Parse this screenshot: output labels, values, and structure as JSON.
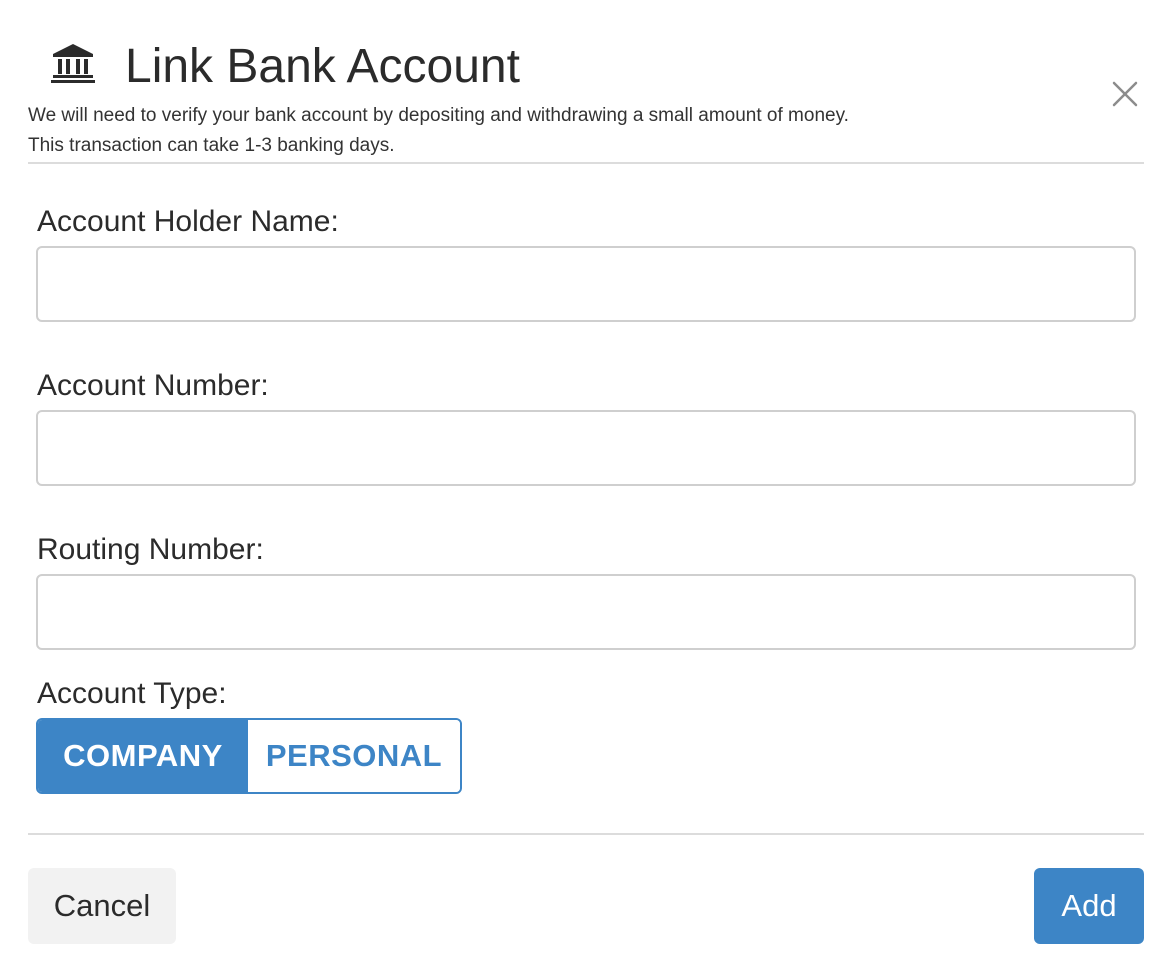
{
  "dialog": {
    "title": "Link Bank Account",
    "icon": "bank-icon",
    "description_line1": "We will need to verify your bank account by depositing and withdrawing a small amount of money.",
    "description_line2": "This transaction can take 1-3 banking days.",
    "close_icon": "close-icon"
  },
  "form": {
    "account_holder": {
      "label": "Account Holder Name:",
      "value": "",
      "placeholder": ""
    },
    "account_number": {
      "label": "Account Number:",
      "value": "",
      "placeholder": ""
    },
    "routing_number": {
      "label": "Routing Number:",
      "value": "",
      "placeholder": ""
    },
    "account_type": {
      "label": "Account Type:",
      "options": [
        "COMPANY",
        "PERSONAL"
      ],
      "selected": "COMPANY"
    }
  },
  "footer": {
    "cancel_label": "Cancel",
    "add_label": "Add"
  },
  "colors": {
    "accent": "#3d85c6",
    "cancel_bg": "#f2f2f2",
    "border": "#cfcfcf"
  }
}
